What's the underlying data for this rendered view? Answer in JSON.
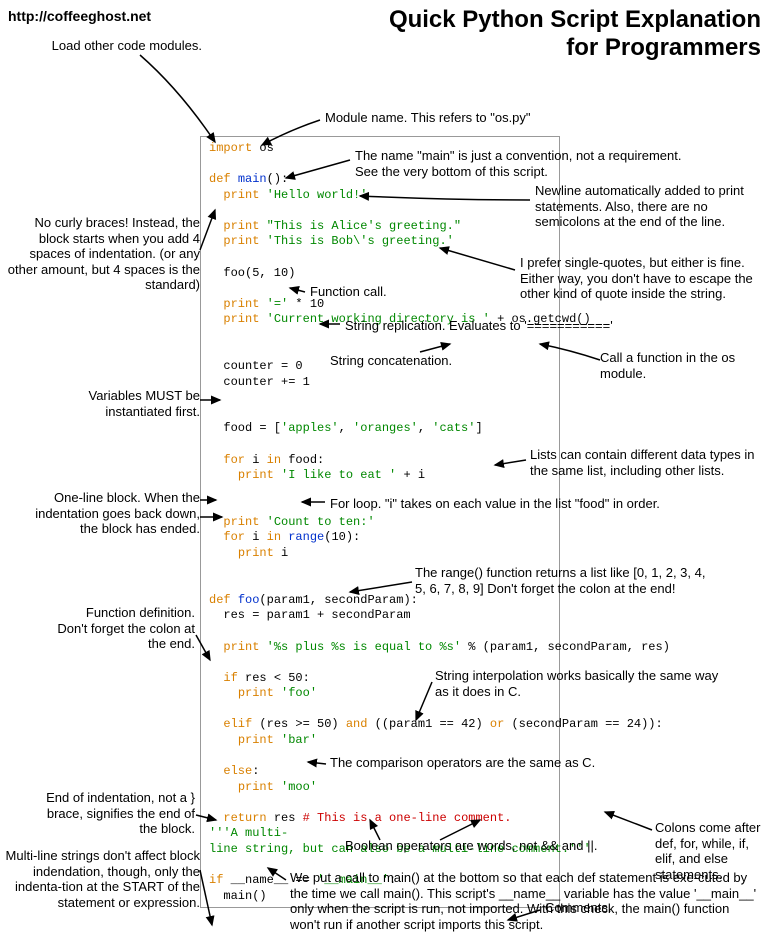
{
  "url": "http://coffeeghost.net",
  "title_line1": "Quick Python Script Explanation",
  "title_line2": "for Programmers",
  "code_lines": [
    [
      [
        "kw",
        "import"
      ],
      [
        "",
        " os"
      ]
    ],
    [],
    [
      [
        "kw",
        "def"
      ],
      [
        "",
        " "
      ],
      [
        "fn",
        "main"
      ],
      [
        "",
        "():"
      ]
    ],
    [
      [
        "",
        "  "
      ],
      [
        "kw",
        "print"
      ],
      [
        "",
        " "
      ],
      [
        "str",
        "'Hello world!'"
      ]
    ],
    [],
    [
      [
        "",
        "  "
      ],
      [
        "kw",
        "print"
      ],
      [
        "",
        " "
      ],
      [
        "str",
        "\"This is Alice's greeting.\""
      ]
    ],
    [
      [
        "",
        "  "
      ],
      [
        "kw",
        "print"
      ],
      [
        "",
        " "
      ],
      [
        "str",
        "'This is Bob\\'s greeting.'"
      ]
    ],
    [],
    [
      [
        "",
        "  foo(5, 10)"
      ]
    ],
    [],
    [
      [
        "",
        "  "
      ],
      [
        "kw",
        "print"
      ],
      [
        "",
        " "
      ],
      [
        "str",
        "'='"
      ],
      [
        "",
        " * 10"
      ]
    ],
    [
      [
        "",
        "  "
      ],
      [
        "kw",
        "print"
      ],
      [
        "",
        " "
      ],
      [
        "str",
        "'Current working directory is '"
      ],
      [
        "",
        " + os.getcwd()"
      ]
    ],
    [],
    [],
    [
      [
        "",
        "  counter = 0"
      ]
    ],
    [
      [
        "",
        "  counter += 1"
      ]
    ],
    [],
    [],
    [
      [
        "",
        "  food = ["
      ],
      [
        "str",
        "'apples'"
      ],
      [
        "",
        ", "
      ],
      [
        "str",
        "'oranges'"
      ],
      [
        "",
        ", "
      ],
      [
        "str",
        "'cats'"
      ],
      [
        "",
        "]"
      ]
    ],
    [],
    [
      [
        "",
        "  "
      ],
      [
        "kw",
        "for"
      ],
      [
        "",
        " i "
      ],
      [
        "kw",
        "in"
      ],
      [
        "",
        " food:"
      ]
    ],
    [
      [
        "",
        "    "
      ],
      [
        "kw",
        "print"
      ],
      [
        "",
        " "
      ],
      [
        "str",
        "'I like to eat '"
      ],
      [
        "",
        " + i"
      ]
    ],
    [],
    [],
    [
      [
        "",
        "  "
      ],
      [
        "kw",
        "print"
      ],
      [
        "",
        " "
      ],
      [
        "str",
        "'Count to ten:'"
      ]
    ],
    [
      [
        "",
        "  "
      ],
      [
        "kw",
        "for"
      ],
      [
        "",
        " i "
      ],
      [
        "kw",
        "in"
      ],
      [
        "",
        " "
      ],
      [
        "fn",
        "range"
      ],
      [
        "",
        "(10):"
      ]
    ],
    [
      [
        "",
        "    "
      ],
      [
        "kw",
        "print"
      ],
      [
        "",
        " i"
      ]
    ],
    [],
    [],
    [
      [
        "kw",
        "def"
      ],
      [
        "",
        " "
      ],
      [
        "fn",
        "foo"
      ],
      [
        "",
        "(param1, secondParam):"
      ]
    ],
    [
      [
        "",
        "  res = param1 + secondParam"
      ]
    ],
    [],
    [
      [
        "",
        "  "
      ],
      [
        "kw",
        "print"
      ],
      [
        "",
        " "
      ],
      [
        "str",
        "'%s plus %s is equal to %s'"
      ],
      [
        "",
        " % (param1, secondParam, res)"
      ]
    ],
    [],
    [
      [
        "",
        "  "
      ],
      [
        "kw",
        "if"
      ],
      [
        "",
        " res < 50:"
      ]
    ],
    [
      [
        "",
        "    "
      ],
      [
        "kw",
        "print"
      ],
      [
        "",
        " "
      ],
      [
        "str",
        "'foo'"
      ]
    ],
    [],
    [
      [
        "",
        "  "
      ],
      [
        "kw",
        "elif"
      ],
      [
        "",
        " (res >= 50) "
      ],
      [
        "kw",
        "and"
      ],
      [
        "",
        " ((param1 == 42) "
      ],
      [
        "kw",
        "or"
      ],
      [
        "",
        " (secondParam == 24)):"
      ]
    ],
    [
      [
        "",
        "    "
      ],
      [
        "kw",
        "print"
      ],
      [
        "",
        " "
      ],
      [
        "str",
        "'bar'"
      ]
    ],
    [],
    [
      [
        "",
        "  "
      ],
      [
        "kw",
        "else"
      ],
      [
        "",
        ":"
      ]
    ],
    [
      [
        "",
        "    "
      ],
      [
        "kw",
        "print"
      ],
      [
        "",
        " "
      ],
      [
        "str",
        "'moo'"
      ]
    ],
    [],
    [
      [
        "",
        "  "
      ],
      [
        "kw",
        "return"
      ],
      [
        "",
        " res "
      ],
      [
        "cmt",
        "# This is a one-line comment."
      ]
    ],
    [
      [
        "str",
        "'''A multi-"
      ]
    ],
    [
      [
        "str",
        "line string, but can also be a multi-line comment.'''"
      ]
    ],
    [],
    [
      [
        "kw",
        "if"
      ],
      [
        "",
        " __name__ == "
      ],
      [
        "str",
        "'__main__'"
      ],
      [
        "",
        ":"
      ]
    ],
    [
      [
        "",
        "  main()"
      ]
    ]
  ],
  "annotations": {
    "a1": "Load other code modules.",
    "a2": "Module name. This refers to \"os.py\"",
    "a3": "The name \"main\" is just a convention, not a requirement. See the very bottom of this script.",
    "a4": "Newline automatically added to print statements. Also, there are no semicolons at the end of the line.",
    "a5": "No curly braces! Instead, the block starts when you add 4 spaces of indentation. (or any other amount, but 4 spaces is the standard)",
    "a6": "I prefer single-quotes, but either is fine. Either way, you don't have to escape the other kind of quote inside the string.",
    "a7": "Function call.",
    "a8": "String replication. Evaluates to '==========='",
    "a9": "String concatenation.",
    "a10": "Call a function in the os module.",
    "a11": "Variables MUST be instantiated first.",
    "a12": "Lists can contain different data types in the same list, including other lists.",
    "a13": "One-line block. When the indentation goes back down, the block has ended.",
    "a14": "For loop. \"i\" takes on each value in the list \"food\" in order.",
    "a15": "The range() function returns a list like [0, 1, 2, 3, 4, 5, 6, 7, 8, 9]  Don't forget the colon at the end!",
    "a16": "Function definition. Don't forget the colon at the end.",
    "a17": "String interpolation works basically the same way as it does in C.",
    "a18": "The comparison operators are the same as C.",
    "a19": "End of indentation, not a } brace, signifies the end of the block.",
    "a20": "Boolean operators are words, not && and ||.",
    "a21": "Colons come after def, for, while, if, elif, and else statements.",
    "a22": "Comments.",
    "a23": "Multi-line strings don't affect block indendation, though, only the indenta-tion at the START of the statement or expression.",
    "a24": "We put a call to main() at the bottom so that each def statement is exe-cuted by the time we call main(). This script's __name__ variable has the value '__main__' only when the script is run, not imported. With this check, the main() function won't run if another script imports this script."
  }
}
